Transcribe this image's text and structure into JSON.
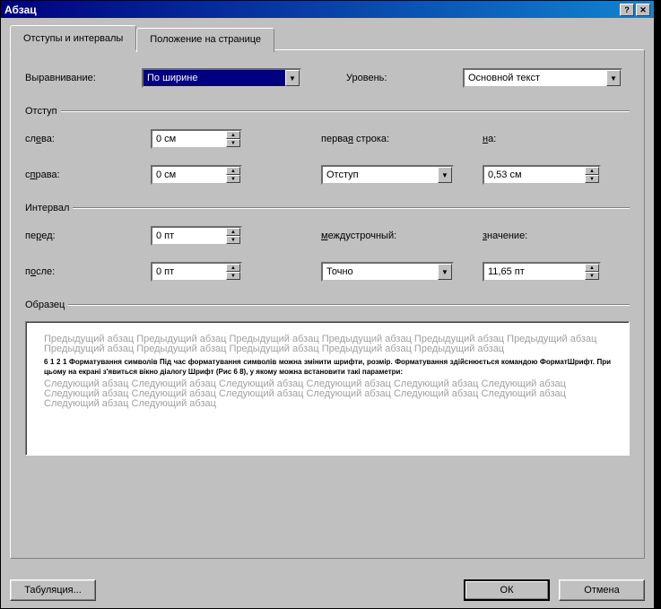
{
  "title": "Абзац",
  "tabs": {
    "t1": "Отступы и интервалы",
    "t2": "Положение на странице"
  },
  "labels": {
    "alignment": "Выравнивание:",
    "level": "Уровень:",
    "indent_group": "Отступ",
    "left": "слева:",
    "right": "справа:",
    "first_line": "первая строка:",
    "by": "на:",
    "spacing_group": "Интервал",
    "before": "перед:",
    "after": "после:",
    "line_spacing": "междустрочный:",
    "at": "значение:",
    "preview": "Образец",
    "tabs_btn": "Табуляция...",
    "ok": "ОК",
    "cancel": "Отмена"
  },
  "values": {
    "alignment": "По ширине",
    "level": "Основной текст",
    "indent_left": "0 см",
    "indent_right": "0 см",
    "first_line": "Отступ",
    "first_line_by": "0,53 см",
    "before": "0 пт",
    "after": "0 пт",
    "line_spacing": "Точно",
    "line_spacing_at": "11,65 пт"
  },
  "preview": {
    "prev_para": "Предыдущий абзац Предыдущий абзац Предыдущий абзац Предыдущий абзац Предыдущий абзац Предыдущий абзац Предыдущий абзац Предыдущий абзац Предыдущий абзац Предыдущий абзац Предыдущий абзац",
    "sample": "6 1 2 1   Форматування символів   Під час форматування символів можна змінити шрифти, розмір. Форматування здійснюється командою ФорматШрифт. При цьому на екрані з'явиться вікно діалогу Шрифт (Рис 6 8), у якому можна встановити такі параметри:",
    "next_para": "Следующий абзац Следующий абзац Следующий абзац Следующий абзац Следующий абзац Следующий абзац Следующий абзац Следующий абзац Следующий абзац Следующий абзац Следующий абзац Следующий абзац Следующий абзац Следующий абзац"
  }
}
